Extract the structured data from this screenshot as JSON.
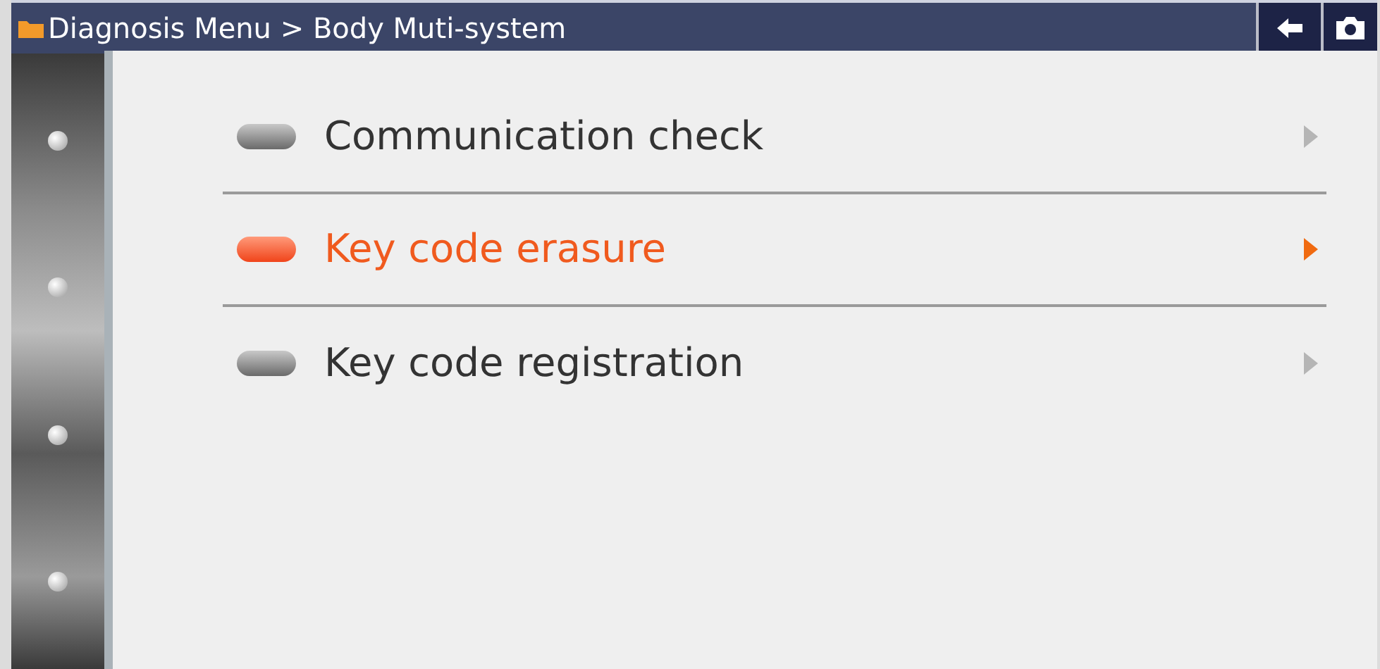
{
  "title_bar": {
    "breadcrumb": "Diagnosis Menu > Body Muti-system"
  },
  "menu": {
    "items": [
      {
        "label": "Communication check",
        "selected": false
      },
      {
        "label": "Key code erasure",
        "selected": true
      },
      {
        "label": "Key code registration",
        "selected": false
      }
    ]
  }
}
